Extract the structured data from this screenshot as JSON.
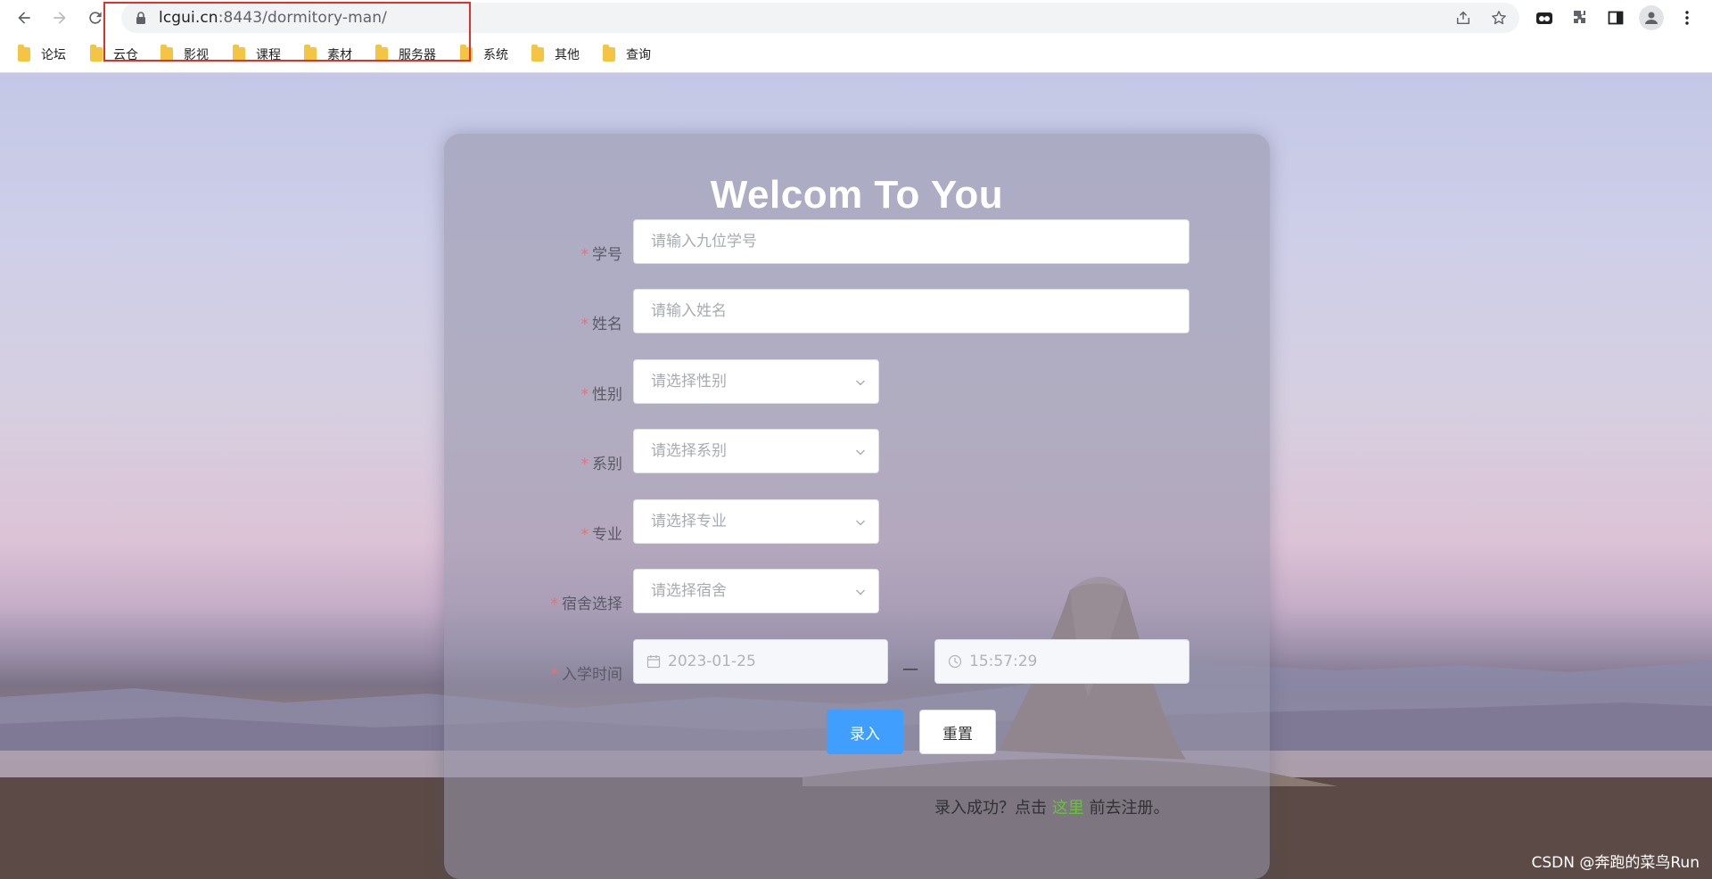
{
  "browser": {
    "url_host": "lcgui.cn",
    "url_rest": ":8443/dormitory-man/",
    "bookmarks": [
      "论坛",
      "云仓",
      "影视",
      "课程",
      "素材",
      "服务器",
      "系统",
      "其他",
      "查询"
    ]
  },
  "form": {
    "title": "Welcom To You",
    "student_id": {
      "label": "学号",
      "placeholder": "请输入九位学号"
    },
    "name": {
      "label": "姓名",
      "placeholder": "请输入姓名"
    },
    "gender": {
      "label": "性别",
      "placeholder": "请选择性别"
    },
    "department": {
      "label": "系别",
      "placeholder": "请选择系别"
    },
    "major": {
      "label": "专业",
      "placeholder": "请选择专业"
    },
    "dorm": {
      "label": "宿舍选择",
      "placeholder": "请选择宿舍"
    },
    "enroll": {
      "label": "入学时间",
      "date": "2023-01-25",
      "separator": "—",
      "time": "15:57:29"
    },
    "required_mark": "*",
    "submit_label": "录入",
    "reset_label": "重置",
    "hint_prefix": "录入成功？点击 ",
    "hint_link": "这里",
    "hint_suffix": " 前去注册。"
  },
  "watermark": "CSDN @奔跑的菜鸟Run",
  "colors": {
    "primary": "#409eff",
    "required": "#f56c6c",
    "link": "#67c23a",
    "highlight": "#e0302b"
  }
}
